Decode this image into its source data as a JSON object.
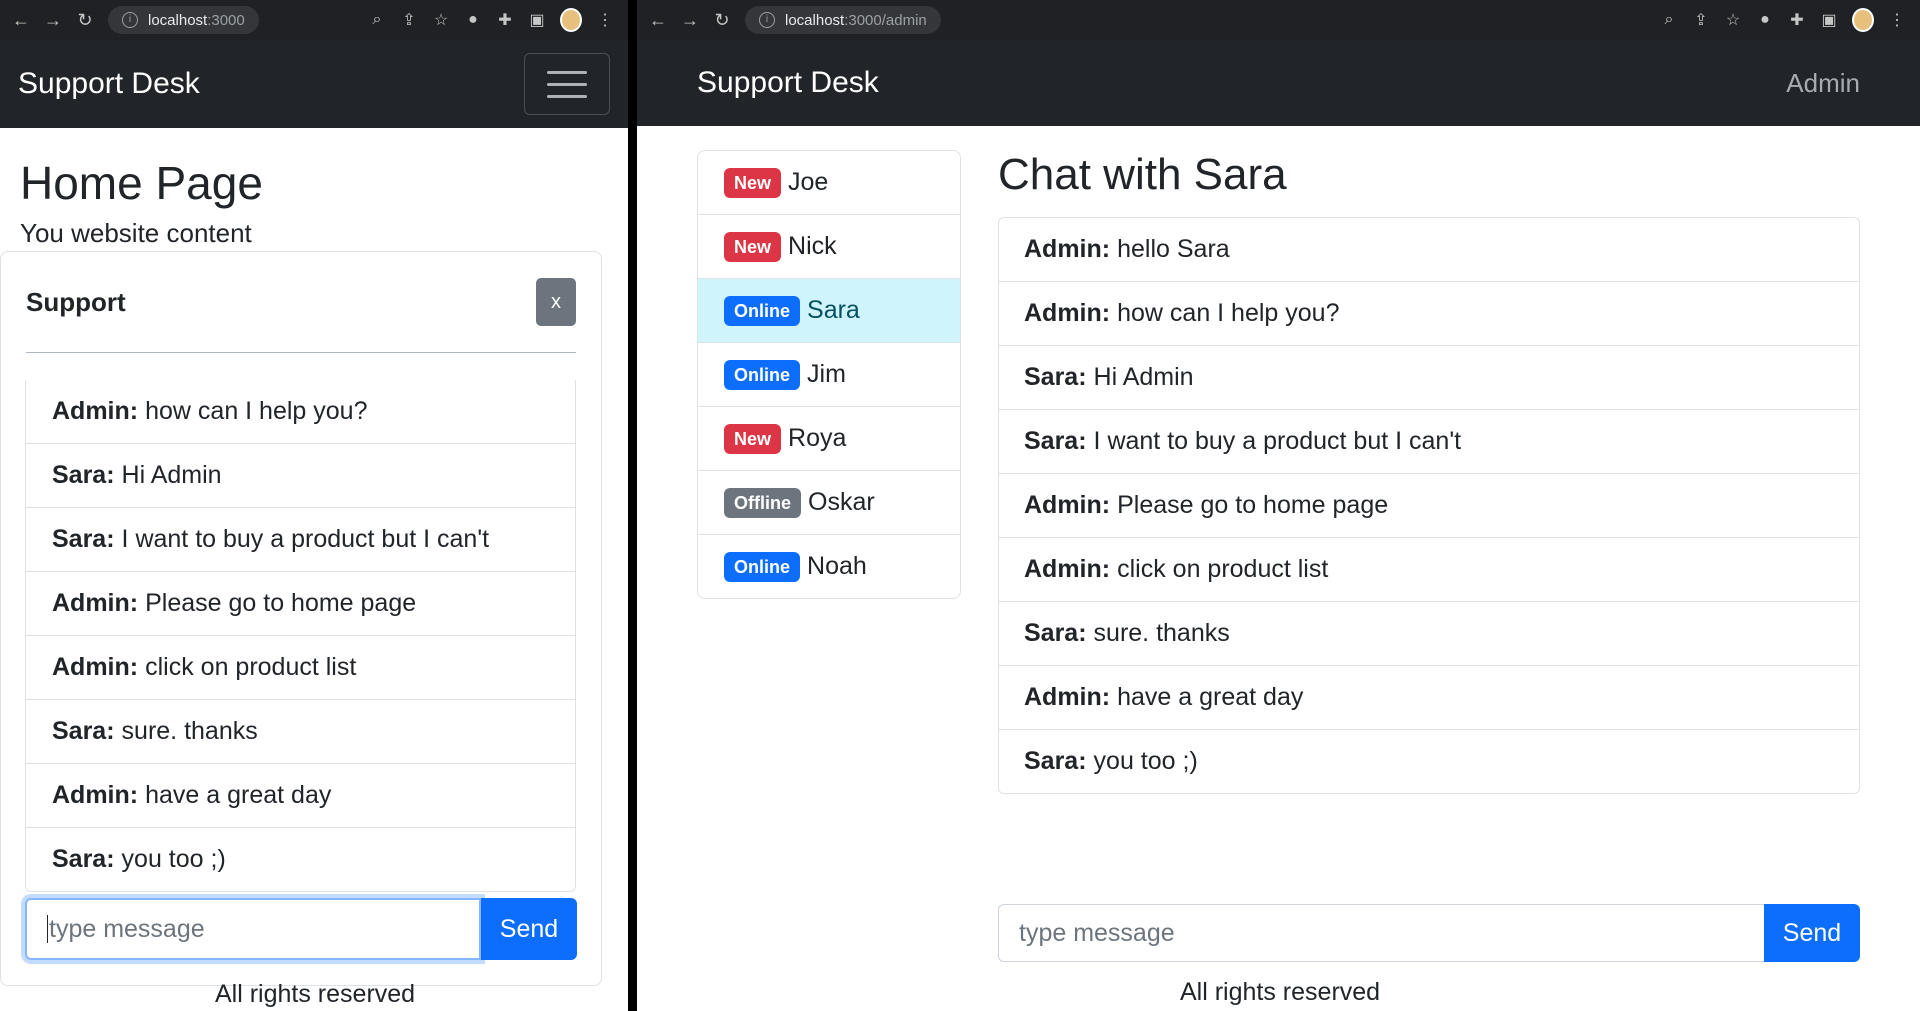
{
  "left_window": {
    "url_host": "localhost",
    "url_path": ":3000",
    "brand": "Support Desk",
    "page_title": "Home Page",
    "page_text": "You website content",
    "support": {
      "title": "Support",
      "close_label": "x",
      "messages": [
        {
          "from": "Admin:",
          "text": "how can I help you?"
        },
        {
          "from": "Sara:",
          "text": "Hi Admin"
        },
        {
          "from": "Sara:",
          "text": "I want to buy a product but I can't"
        },
        {
          "from": "Admin:",
          "text": "Please go to home page"
        },
        {
          "from": "Admin:",
          "text": "click on product list"
        },
        {
          "from": "Sara:",
          "text": "sure. thanks"
        },
        {
          "from": "Admin:",
          "text": "have a great day"
        },
        {
          "from": "Sara:",
          "text": "you too ;)"
        }
      ],
      "input_placeholder": "type message",
      "send_label": "Send"
    },
    "footer": "All rights reserved"
  },
  "right_window": {
    "url_host": "localhost",
    "url_path": ":3000/admin",
    "brand": "Support Desk",
    "admin_link": "Admin",
    "users": [
      {
        "badge": "New",
        "status": "new",
        "name": "Joe"
      },
      {
        "badge": "New",
        "status": "new",
        "name": "Nick"
      },
      {
        "badge": "Online",
        "status": "online",
        "name": "Sara"
      },
      {
        "badge": "Online",
        "status": "online",
        "name": "Jim"
      },
      {
        "badge": "New",
        "status": "new",
        "name": "Roya"
      },
      {
        "badge": "Offline",
        "status": "offline",
        "name": "Oskar"
      },
      {
        "badge": "Online",
        "status": "online",
        "name": "Noah"
      }
    ],
    "chat_title": "Chat with Sara",
    "messages": [
      {
        "from": "Admin:",
        "text": "hello Sara"
      },
      {
        "from": "Admin:",
        "text": "how can I help you?"
      },
      {
        "from": "Sara:",
        "text": "Hi Admin"
      },
      {
        "from": "Sara:",
        "text": "I want to buy a product but I can't"
      },
      {
        "from": "Admin:",
        "text": "Please go to home page"
      },
      {
        "from": "Admin:",
        "text": "click on product list"
      },
      {
        "from": "Sara:",
        "text": "sure. thanks"
      },
      {
        "from": "Admin:",
        "text": "have a great day"
      },
      {
        "from": "Sara:",
        "text": "you too ;)"
      }
    ],
    "input_placeholder": "type message",
    "send_label": "Send",
    "footer": "All rights reserved"
  },
  "colors": {
    "navbar": "#212529",
    "primary": "#0d6efd",
    "danger": "#dc3545",
    "secondary": "#6c757d",
    "active_row": "#cff4fc"
  }
}
